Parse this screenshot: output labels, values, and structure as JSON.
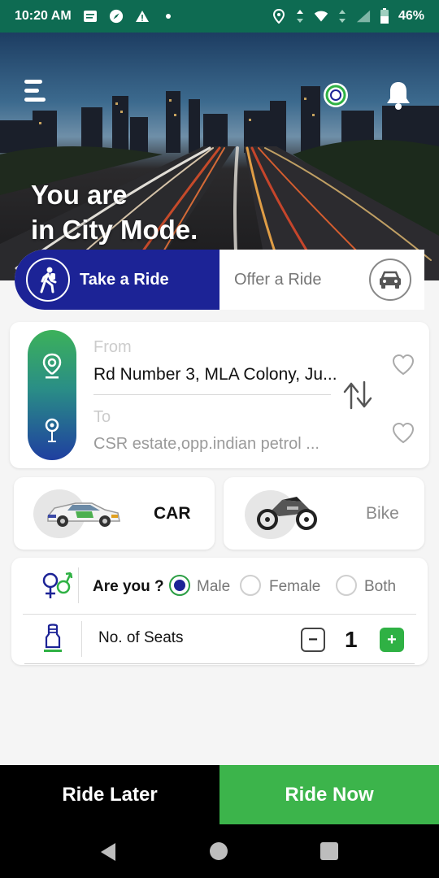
{
  "status_bar": {
    "time": "10:20 AM",
    "battery": "46%"
  },
  "hero": {
    "title_line1": "You are",
    "title_line2": "in City Mode."
  },
  "ride_toggle": {
    "take_ride": "Take a Ride",
    "offer_ride": "Offer a Ride"
  },
  "location": {
    "from_label": "From",
    "from_value": "Rd Number 3, MLA Colony, Ju...",
    "to_label": "To",
    "to_value": "CSR estate,opp.indian petrol ..."
  },
  "vehicles": {
    "car_label": "CAR",
    "bike_label": "Bike"
  },
  "preferences": {
    "are_you_label": "Are you ?",
    "options": [
      "Male",
      "Female",
      "Both"
    ],
    "selected": "Male",
    "seats_label": "No. of Seats",
    "seats_value": "1",
    "minus": "−",
    "plus": "+"
  },
  "actions": {
    "ride_later": "Ride Later",
    "ride_now": "Ride Now"
  },
  "colors": {
    "primary_blue": "#1c2396",
    "accent_green": "#3cb44b",
    "status_bar": "#0e6b52"
  }
}
